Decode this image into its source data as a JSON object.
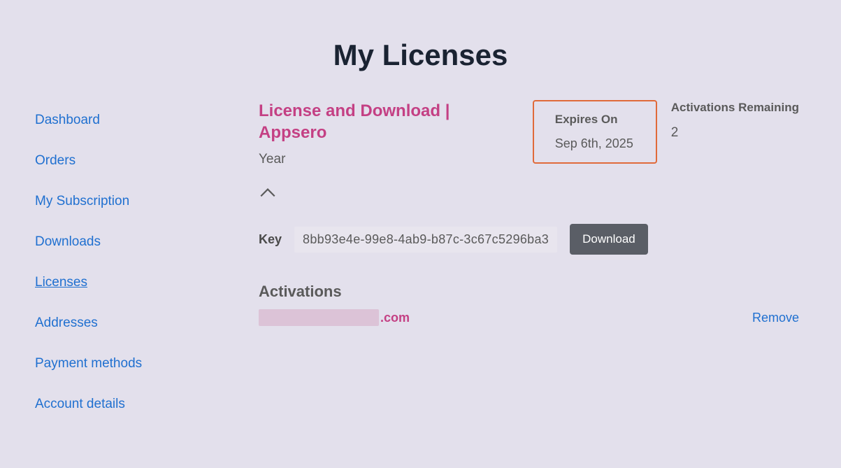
{
  "page": {
    "title": "My Licenses"
  },
  "sidebar": {
    "items": [
      {
        "label": "Dashboard",
        "active": false
      },
      {
        "label": "Orders",
        "active": false
      },
      {
        "label": "My Subscription",
        "active": false
      },
      {
        "label": "Downloads",
        "active": false
      },
      {
        "label": "Licenses",
        "active": true
      },
      {
        "label": "Addresses",
        "active": false
      },
      {
        "label": "Payment methods",
        "active": false
      },
      {
        "label": "Account details",
        "active": false
      }
    ]
  },
  "license": {
    "title": "License and Download | Appsero",
    "subtitle": "Year",
    "expires": {
      "label": "Expires On",
      "date": "Sep 6th, 2025"
    },
    "activations_remaining": {
      "label": "Activations Remaining",
      "count": "2"
    },
    "key": {
      "label": "Key",
      "value": "8bb93e4e-99e8-4ab9-b87c-3c67c5296ba3"
    },
    "download_label": "Download",
    "activations": {
      "heading": "Activations",
      "site_suffix": ".com",
      "remove_label": "Remove"
    }
  }
}
